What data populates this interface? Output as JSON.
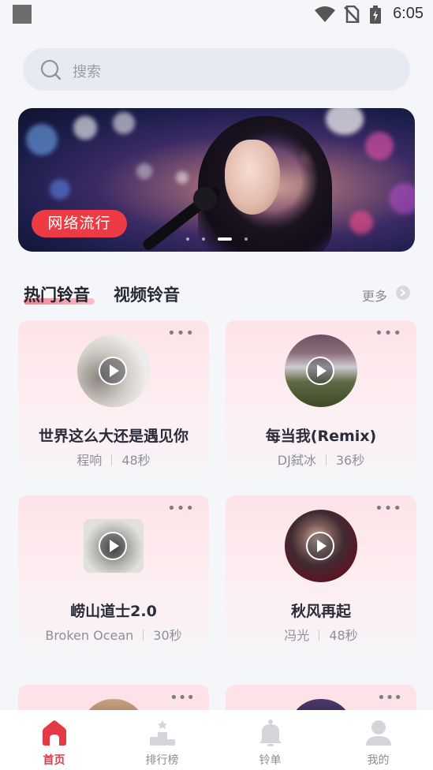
{
  "status_bar": {
    "time": "6:05"
  },
  "search": {
    "placeholder": "搜索"
  },
  "banner": {
    "tag": "网络流行"
  },
  "tabs": [
    {
      "label": "热门铃音"
    },
    {
      "label": "视频铃音"
    }
  ],
  "more_label": "更多",
  "cards": [
    {
      "title": "世界这么大还是遇见你",
      "artist": "程响",
      "duration": "48秒"
    },
    {
      "title": "每当我(Remix)",
      "artist": "DJ弑冰",
      "duration": "36秒"
    },
    {
      "title": "崂山道士2.0",
      "artist": "Broken Ocean",
      "duration": "30秒"
    },
    {
      "title": "秋风再起",
      "artist": "冯光",
      "duration": "48秒"
    }
  ],
  "nav": [
    {
      "label": "首页",
      "icon": "home-icon",
      "active": true
    },
    {
      "label": "排行榜",
      "icon": "podium-icon",
      "active": false
    },
    {
      "label": "铃单",
      "icon": "bell-icon",
      "active": false
    },
    {
      "label": "我的",
      "icon": "user-icon",
      "active": false
    }
  ],
  "colors": {
    "accent": "#e43a45",
    "card_bg": "#fde3e8",
    "search_bg": "#e8eaf3"
  }
}
